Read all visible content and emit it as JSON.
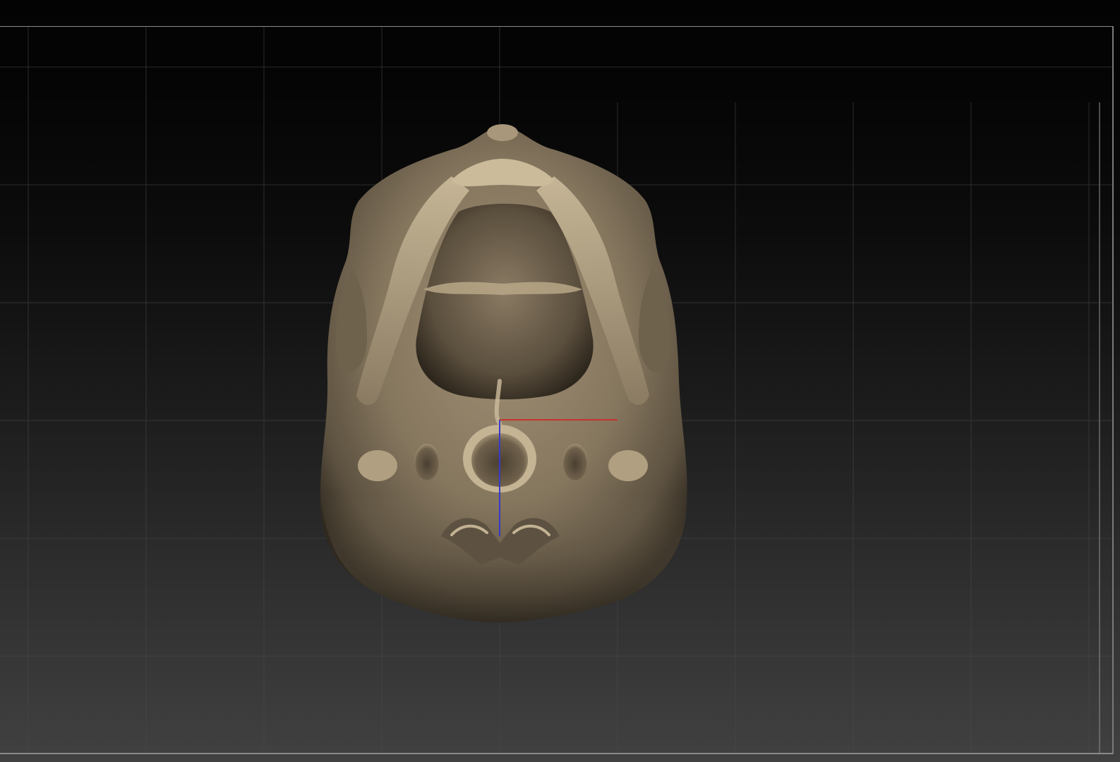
{
  "viewport": {
    "background_top": "#030303",
    "background_bottom": "#414141",
    "grid_color": "#4a4a4a",
    "frame_color": "#8a8a8a"
  },
  "model": {
    "name_icon": "sculpt-mesh",
    "material_base": "#8f7f66",
    "material_light": "#c9b898",
    "material_dark": "#3a3226"
  },
  "gizmo": {
    "x_axis_color": "#c8332e",
    "z_axis_color": "#3a38c8"
  }
}
